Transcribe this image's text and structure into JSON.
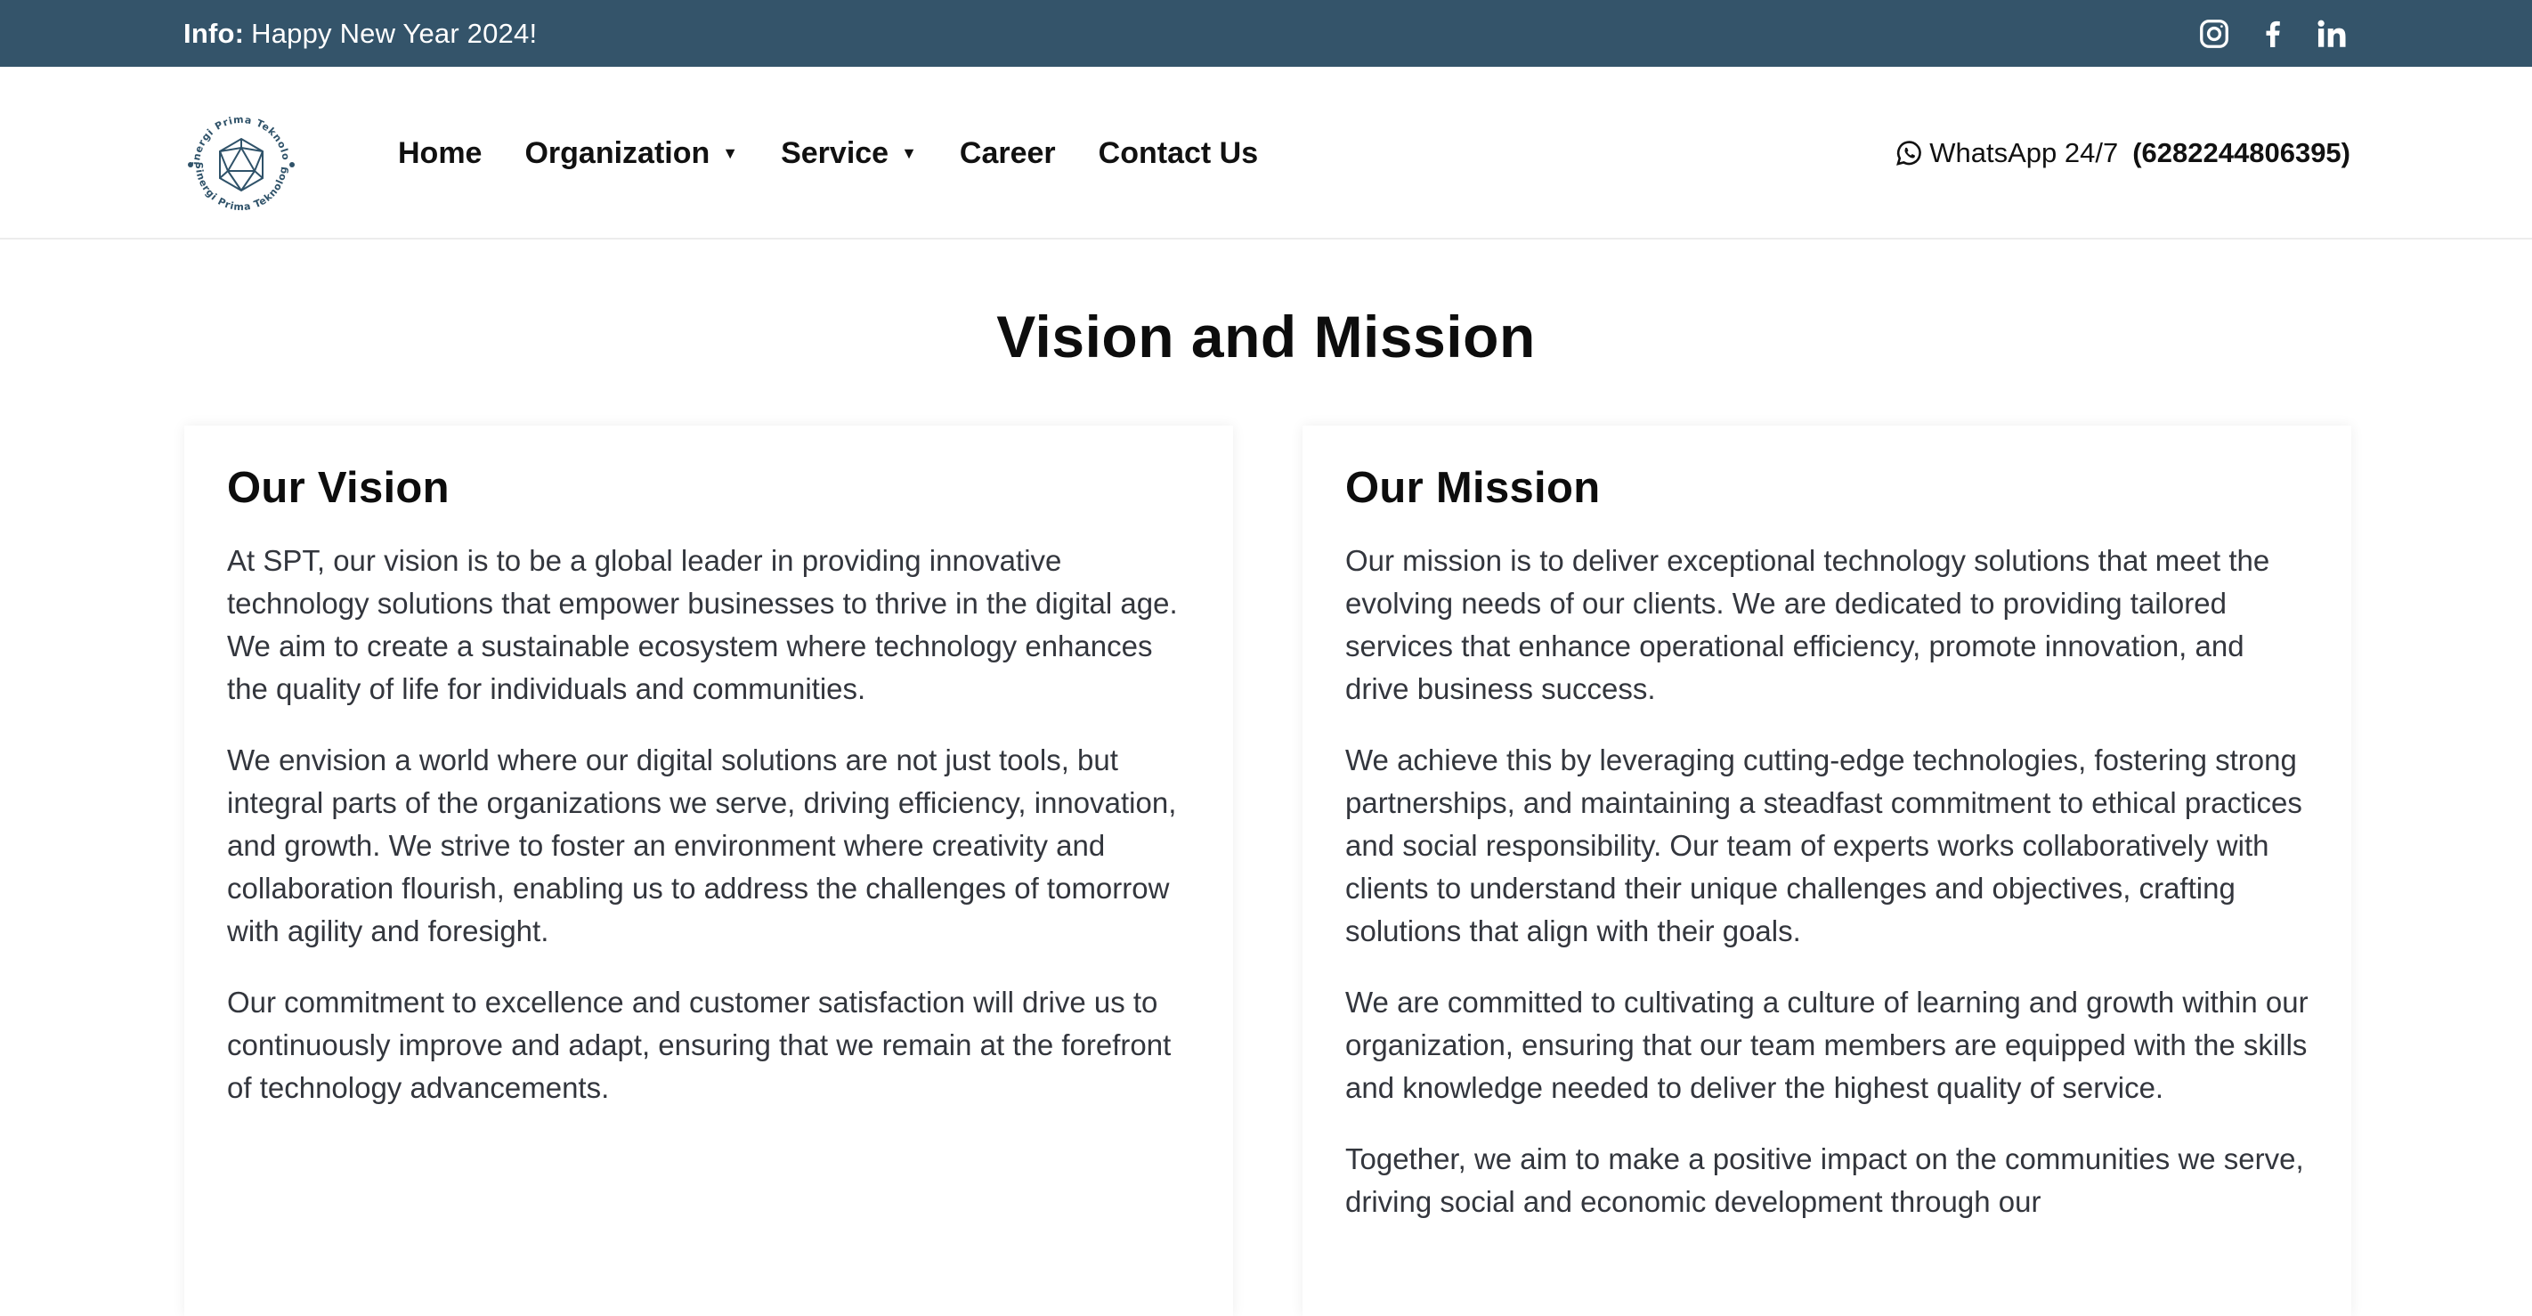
{
  "topbar": {
    "info_label": "Info:",
    "info_text": "Happy New Year 2024!",
    "socials": [
      "instagram-icon",
      "facebook-icon",
      "linkedin-icon"
    ],
    "bg_color": "#34546a"
  },
  "header": {
    "logo_text_top": "Sinergi Prima Teknologi",
    "logo_text_bottom": "Sinergi Prima Teknologi",
    "nav": [
      {
        "label": "Home",
        "dropdown": false
      },
      {
        "label": "Organization",
        "dropdown": true
      },
      {
        "label": "Service",
        "dropdown": true
      },
      {
        "label": "Career",
        "dropdown": false
      },
      {
        "label": "Contact Us",
        "dropdown": false
      }
    ],
    "whatsapp_label": "WhatsApp 24/7",
    "whatsapp_number": "(6282244806395)"
  },
  "main": {
    "title": "Vision and Mission",
    "vision": {
      "heading": "Our Vision",
      "paragraphs": [
        "At SPT, our vision is to be a global leader in providing innovative technology solutions that empower businesses to thrive in the digital age. We aim to create a sustainable ecosystem where technology enhances the quality of life for individuals and communities.",
        "We envision a world where our digital solutions are not just tools, but integral parts of the organizations we serve, driving efficiency, innovation, and growth. We strive to foster an environment where creativity and collaboration flourish, enabling us to address the challenges of tomorrow with agility and foresight.",
        "Our commitment to excellence and customer satisfaction will drive us to continuously improve and adapt, ensuring that we remain at the forefront of technology advancements."
      ]
    },
    "mission": {
      "heading": "Our Mission",
      "paragraphs": [
        "Our mission is to deliver exceptional technology solutions that meet the evolving needs of our clients. We are dedicated to providing tailored services that enhance operational efficiency, promote innovation, and drive business success.",
        "We achieve this by leveraging cutting-edge technologies, fostering strong partnerships, and maintaining a steadfast commitment to ethical practices and social responsibility. Our team of experts works collaboratively with clients to understand their unique challenges and objectives, crafting solutions that align with their goals.",
        "We are committed to cultivating a culture of learning and growth within our organization, ensuring that our team members are equipped with the skills and knowledge needed to deliver the highest quality of service.",
        "Together, we aim to make a positive impact on the communities we serve, driving social and economic development through our"
      ]
    }
  }
}
